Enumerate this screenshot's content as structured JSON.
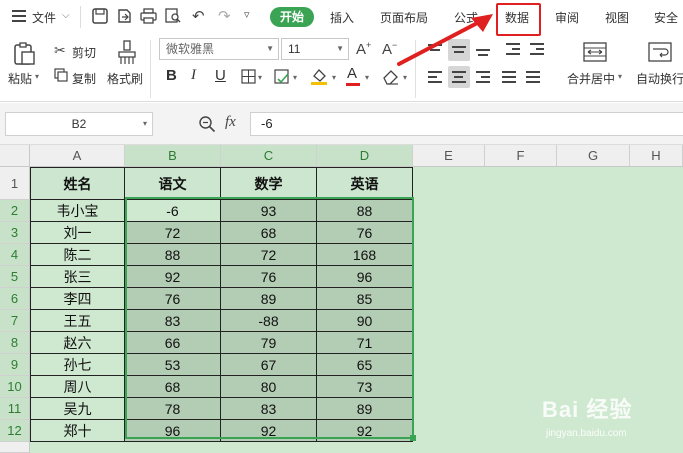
{
  "menu": {
    "file_label": "文件",
    "tabs": [
      "开始",
      "插入",
      "页面布局",
      "公式",
      "数据",
      "审阅",
      "视图",
      "安全"
    ]
  },
  "ribbon": {
    "paste": "粘贴",
    "cut": "剪切",
    "copy": "复制",
    "format_painter": "格式刷",
    "font_name": "微软雅黑",
    "font_size": "11",
    "bold": "B",
    "italic": "I",
    "underline": "U",
    "font_color_glyph": "A",
    "merge_center": "合并居中",
    "wrap_text": "自动换行"
  },
  "formula_bar": {
    "cell_ref": "B2",
    "fx": "fx",
    "value": "-6"
  },
  "sheet": {
    "columns": [
      "A",
      "B",
      "C",
      "D",
      "E",
      "F",
      "G",
      "H"
    ],
    "rows": [
      "1",
      "2",
      "3",
      "4",
      "5",
      "6",
      "7",
      "8",
      "9",
      "10",
      "11",
      "12"
    ],
    "header": [
      "姓名",
      "语文",
      "数学",
      "英语"
    ],
    "data": [
      [
        "韦小宝",
        "-6",
        "93",
        "88"
      ],
      [
        "刘一",
        "72",
        "68",
        "76"
      ],
      [
        "陈二",
        "88",
        "72",
        "168"
      ],
      [
        "张三",
        "92",
        "76",
        "96"
      ],
      [
        "李四",
        "76",
        "89",
        "85"
      ],
      [
        "王五",
        "83",
        "-88",
        "90"
      ],
      [
        "赵六",
        "66",
        "79",
        "71"
      ],
      [
        "孙七",
        "53",
        "67",
        "65"
      ],
      [
        "周八",
        "68",
        "80",
        "73"
      ],
      [
        "吴九",
        "78",
        "83",
        "89"
      ],
      [
        "郑十",
        "96",
        "92",
        "92"
      ]
    ]
  },
  "watermark": {
    "brand": "Bai 经验",
    "url": "jingyan.baidu.com"
  },
  "colors": {
    "accent": "#3aa454",
    "highlight_box": "#e02020",
    "sheet_bg": "#cfe8d0",
    "selected_cells": "#b3ccb4"
  }
}
